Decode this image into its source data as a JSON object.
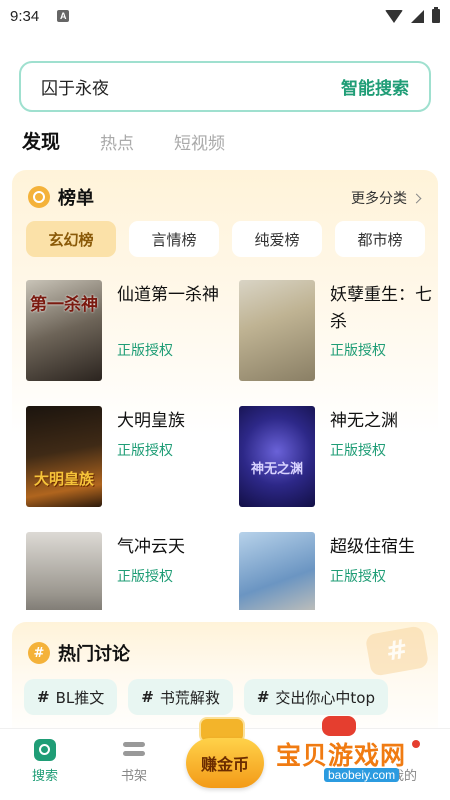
{
  "status_bar": {
    "time": "9:34",
    "notif": "A"
  },
  "search": {
    "value": "囚于永夜",
    "button": "智能搜索"
  },
  "tabs": [
    {
      "label": "发现"
    },
    {
      "label": "热点"
    },
    {
      "label": "短视频"
    }
  ],
  "ranking": {
    "title": "榜单",
    "more": "更多分类",
    "categories": [
      {
        "label": "玄幻榜"
      },
      {
        "label": "言情榜"
      },
      {
        "label": "纯爱榜"
      },
      {
        "label": "都市榜"
      }
    ],
    "books": [
      {
        "title": "仙道第一杀神",
        "tag": "正版授权",
        "cover_text": "第一杀神"
      },
      {
        "title": "妖孽重生：七杀",
        "tag": "正版授权",
        "cover_text": ""
      },
      {
        "title": "大明皇族",
        "tag": "正版授权",
        "cover_text": "大明皇族"
      },
      {
        "title": "神无之渊",
        "tag": "正版授权",
        "cover_text": "神无之渊"
      },
      {
        "title": "气冲云天",
        "tag": "正版授权",
        "cover_text": ""
      },
      {
        "title": "超级住宿生",
        "tag": "正版授权",
        "cover_text": ""
      }
    ]
  },
  "hot": {
    "title": "热门讨论",
    "chips": [
      {
        "label": "BL推文"
      },
      {
        "label": "书荒解救"
      },
      {
        "label": "交出你心中top"
      }
    ]
  },
  "nav": {
    "search": "搜索",
    "shelf": "书架",
    "earn": "赚金币",
    "mine": "我的"
  },
  "watermark": {
    "text": "宝贝游戏网",
    "url": "baobeiy.com"
  },
  "colors": {
    "accent": "#1f9d76",
    "gold": "#f4b23a"
  }
}
